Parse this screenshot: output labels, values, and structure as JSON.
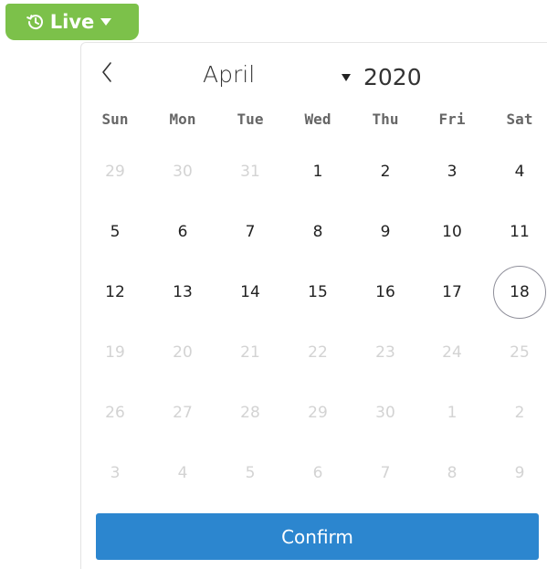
{
  "live_menu": {
    "label": "Live",
    "icon": "history-icon",
    "caret_icon": "caret-down-icon",
    "color": "#7cc14a"
  },
  "calendar": {
    "prev_icon": "chevron-left-icon",
    "month": "April",
    "year": "2020",
    "year_caret_icon": "caret-down-icon",
    "weekdays": [
      "Sun",
      "Mon",
      "Tue",
      "Wed",
      "Thu",
      "Fri",
      "Sat"
    ],
    "weeks": [
      [
        {
          "d": "29",
          "m": true
        },
        {
          "d": "30",
          "m": true
        },
        {
          "d": "31",
          "m": true
        },
        {
          "d": "1"
        },
        {
          "d": "2"
        },
        {
          "d": "3"
        },
        {
          "d": "4"
        }
      ],
      [
        {
          "d": "5"
        },
        {
          "d": "6"
        },
        {
          "d": "7"
        },
        {
          "d": "8"
        },
        {
          "d": "9"
        },
        {
          "d": "10"
        },
        {
          "d": "11"
        }
      ],
      [
        {
          "d": "12"
        },
        {
          "d": "13"
        },
        {
          "d": "14"
        },
        {
          "d": "15"
        },
        {
          "d": "16"
        },
        {
          "d": "17"
        },
        {
          "d": "18",
          "selected": true
        }
      ],
      [
        {
          "d": "19",
          "m": true
        },
        {
          "d": "20",
          "m": true
        },
        {
          "d": "21",
          "m": true
        },
        {
          "d": "22",
          "m": true
        },
        {
          "d": "23",
          "m": true
        },
        {
          "d": "24",
          "m": true
        },
        {
          "d": "25",
          "m": true
        }
      ],
      [
        {
          "d": "26",
          "m": true
        },
        {
          "d": "27",
          "m": true
        },
        {
          "d": "28",
          "m": true
        },
        {
          "d": "29",
          "m": true
        },
        {
          "d": "30",
          "m": true
        },
        {
          "d": "1",
          "m": true
        },
        {
          "d": "2",
          "m": true
        }
      ],
      [
        {
          "d": "3",
          "m": true
        },
        {
          "d": "4",
          "m": true
        },
        {
          "d": "5",
          "m": true
        },
        {
          "d": "6",
          "m": true
        },
        {
          "d": "7",
          "m": true
        },
        {
          "d": "8",
          "m": true
        },
        {
          "d": "9",
          "m": true
        }
      ]
    ],
    "selected_day": "18"
  },
  "confirm": {
    "label": "Confirm",
    "color": "#2c86cf"
  }
}
